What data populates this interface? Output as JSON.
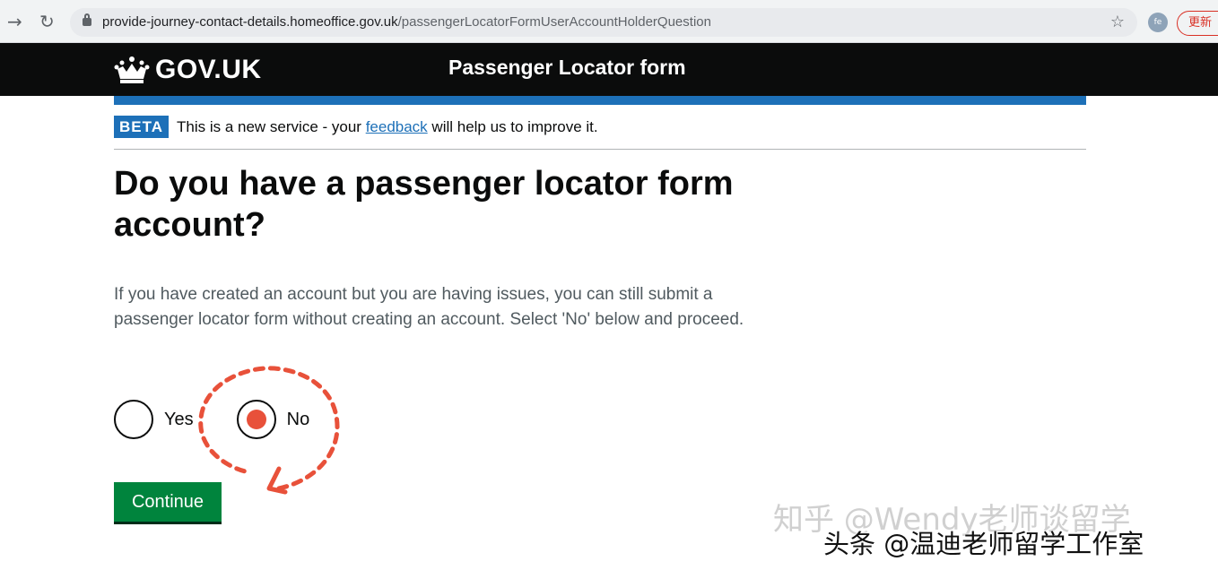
{
  "browser": {
    "url_domain": "provide-journey-contact-details.homeoffice.gov.uk",
    "url_path": "/passengerLocatorFormUserAccountHolderQuestion",
    "profile_initials": "fe",
    "update_label": "更新"
  },
  "header": {
    "logo_text": "GOV.UK",
    "service_name": "Passenger Locator form"
  },
  "phase_banner": {
    "tag": "BETA",
    "text_before": "This is a new service - your ",
    "link_text": "feedback",
    "text_after": " will help us to improve it."
  },
  "question": {
    "heading": "Do you have a passenger locator form account?",
    "hint": "If you have created an account but you are having issues, you can still submit a passenger locator form without creating an account. Select 'No' below and proceed.",
    "options": [
      {
        "label": "Yes",
        "selected": false
      },
      {
        "label": "No",
        "selected": true
      }
    ]
  },
  "actions": {
    "continue_label": "Continue"
  },
  "watermarks": {
    "primary": "知乎 @Wendy老师谈留学",
    "secondary": "头条 @温迪老师留学工作室"
  },
  "colors": {
    "header_bg": "#0b0c0c",
    "brand_blue": "#1d70b8",
    "button_green": "#00843d",
    "annotation_red": "#e8513a"
  }
}
